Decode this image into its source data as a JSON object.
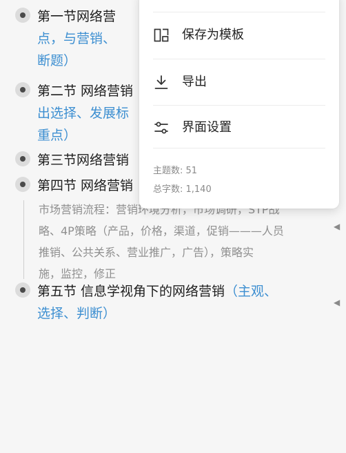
{
  "outline": {
    "nodes": [
      {
        "title": "第一节网络营",
        "tag_line1": "点，与营销、",
        "tag_line2": "断题）"
      },
      {
        "title": "第二节 网络营销",
        "tag_line1": "出选择、发展标",
        "tag_line2": "重点）"
      },
      {
        "title": "第三节网络营销"
      },
      {
        "title": "第四节 网络营销"
      },
      {
        "title": "第五节 信息学视角下的网络营销",
        "tag_line1": "（主观、",
        "tag_line2": "选择、判断）"
      }
    ],
    "note_lines": [
      "市场营销流程：营销环境分析，市场调研，STP战",
      "略、4P策略（产品，价格，渠道，促销———人员",
      "推销、公共关系、营业推广，广告），策略实",
      "施，监控，修正"
    ]
  },
  "menu": {
    "items": [
      {
        "label": "保存为模板",
        "icon": "template-icon"
      },
      {
        "label": "导出",
        "icon": "download-icon"
      },
      {
        "label": "界面设置",
        "icon": "sliders-icon"
      }
    ],
    "topic_count": "主题数: 51",
    "word_count": "总字数: 1,140"
  },
  "colors": {
    "accent": "#3d8fd1",
    "note": "#8f8f8f",
    "background": "#f6f6f6"
  }
}
